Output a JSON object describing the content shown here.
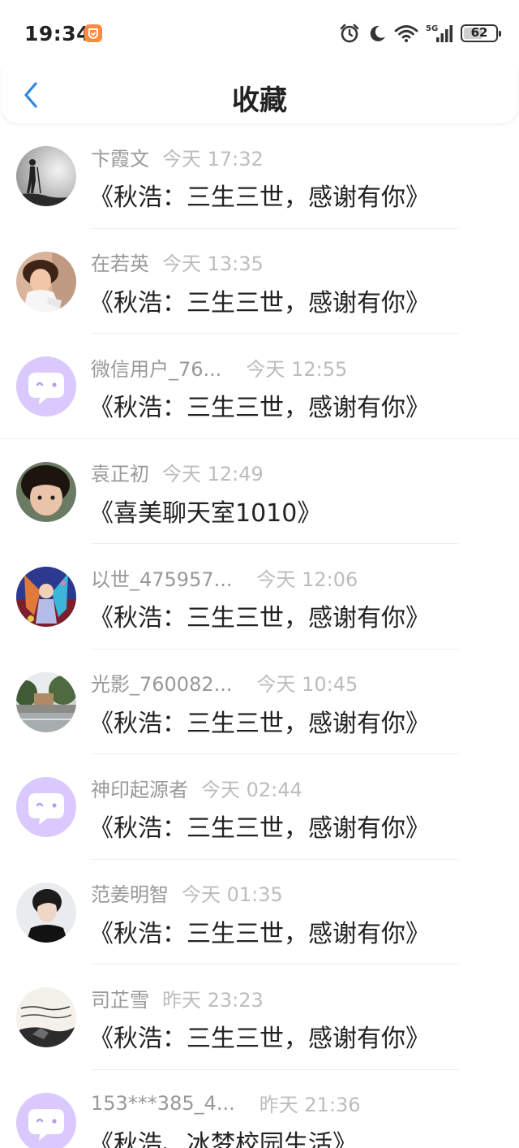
{
  "status_bar": {
    "time": "19:34",
    "battery": "62",
    "battery_level_percent": 62,
    "icons": [
      "app-notification-icon",
      "alarm-icon",
      "moon-icon",
      "wifi-icon",
      "5g-signal-icon",
      "battery-icon"
    ]
  },
  "header": {
    "title": "收藏",
    "back_icon": "chevron-left-icon"
  },
  "colors": {
    "accent": "#2f86e4",
    "author_text": "#999999",
    "time_text": "#bdbdbd",
    "default_avatar_bg": "#d9c9ff",
    "badge": "#ff8a3d"
  },
  "items": [
    {
      "author": "卞霞文",
      "time": "今天 17:32",
      "title": "《秋浩：三生三世，感谢有你》",
      "avatar": "hiker-avatar"
    },
    {
      "author": "在若英",
      "time": "今天 13:35",
      "title": "《秋浩：三生三世，感谢有你》",
      "avatar": "child-photo-avatar"
    },
    {
      "author": "微信用户_76...",
      "time": "今天 12:55",
      "title": "《秋浩：三生三世，感谢有你》",
      "avatar": "default-chat-avatar"
    },
    {
      "author": "袁正初",
      "time": "今天 12:49",
      "title": "《喜美聊天室1010》",
      "avatar": "child-face-avatar"
    },
    {
      "author": "以世_475957...",
      "time": "今天 12:06",
      "title": "《秋浩：三生三世，感谢有你》",
      "avatar": "colorful-art-avatar"
    },
    {
      "author": "光影_760082...",
      "time": "今天 10:45",
      "title": "《秋浩：三生三世，感谢有你》",
      "avatar": "street-photo-avatar"
    },
    {
      "author": "神印起源者",
      "time": "今天 02:44",
      "title": "《秋浩：三生三世，感谢有你》",
      "avatar": "default-chat-avatar"
    },
    {
      "author": "范姜明智",
      "time": "今天 01:35",
      "title": "《秋浩：三生三世，感谢有你》",
      "avatar": "portrait-avatar"
    },
    {
      "author": "司芷雪",
      "time": "昨天 23:23",
      "title": "《秋浩：三生三世，感谢有你》",
      "avatar": "calligraphy-avatar"
    },
    {
      "author": "153***385_4...",
      "time": "昨天 21:36",
      "title": "《秋浩、冰梦校园生活》",
      "avatar": "default-chat-avatar"
    }
  ]
}
